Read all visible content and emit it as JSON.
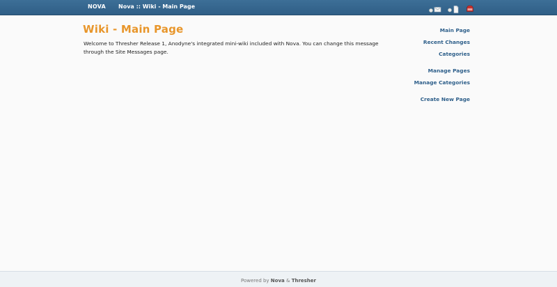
{
  "topbar": {
    "brand": "NOVA",
    "title": "Nova :: Wiki - Main Page",
    "icons": [
      {
        "name": "mail-icon"
      },
      {
        "name": "document-icon"
      },
      {
        "name": "exit-icon"
      }
    ]
  },
  "main": {
    "heading": "Wiki - Main Page",
    "intro": "Welcome to Thresher Release 1, Anodyne's integrated mini-wiki included with Nova. You can change this message through the Site Messages page."
  },
  "sidebar": {
    "links": [
      {
        "label": "Main Page"
      },
      {
        "label": "Recent Changes"
      },
      {
        "label": "Categories"
      },
      {
        "label": "Manage Pages"
      },
      {
        "label": "Manage Categories"
      },
      {
        "label": "Create New Page"
      }
    ]
  },
  "footer": {
    "prefix": "Powered by ",
    "nova": "Nova",
    "amp": " & ",
    "thresher": "Thresher"
  }
}
